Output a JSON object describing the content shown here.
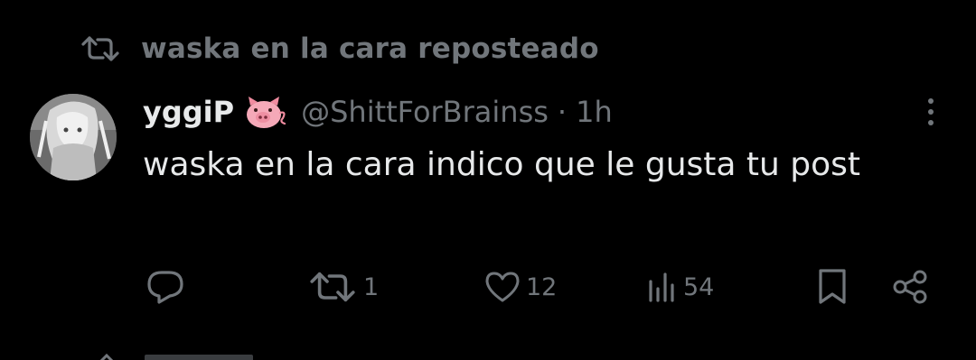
{
  "repost_banner": {
    "icon": "repost-icon",
    "text": "waska en la cara reposteado"
  },
  "tweet": {
    "author": {
      "display_name": "yggiP",
      "emoji": "pig-face-emoji",
      "handle": "@ShittForBrainss",
      "separator": "·",
      "time": "1h"
    },
    "text": "waska en la cara indico que le gusta tu post",
    "actions": {
      "reply": {
        "icon": "reply-icon",
        "count": ""
      },
      "repost": {
        "icon": "repost-icon",
        "count": "1"
      },
      "like": {
        "icon": "heart-icon",
        "count": "12"
      },
      "views": {
        "icon": "views-icon",
        "count": "54"
      },
      "bookmark": {
        "icon": "bookmark-icon"
      },
      "share": {
        "icon": "share-icon"
      }
    }
  },
  "colors": {
    "background": "#000000",
    "primary_text": "#e7e9ea",
    "secondary_text": "#71767b"
  }
}
